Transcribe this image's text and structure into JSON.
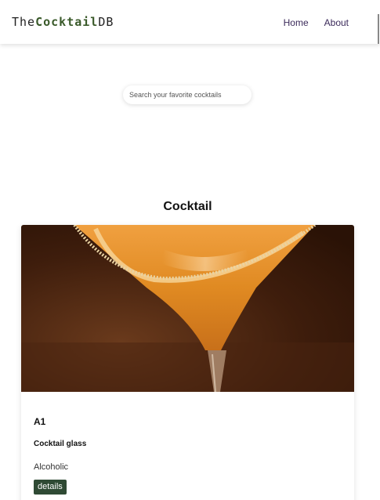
{
  "navbar": {
    "logo_prefix": "The",
    "logo_brand": "Cocktail",
    "logo_suffix": "DB",
    "links": [
      {
        "label": "Home"
      },
      {
        "label": "About"
      }
    ]
  },
  "search": {
    "placeholder": "Search your favorite cocktails",
    "value": ""
  },
  "section": {
    "title": "Cocktail"
  },
  "cocktails": [
    {
      "name": "A1",
      "glass": "Cocktail glass",
      "type": "Alcoholic",
      "details_label": "details",
      "image_icon": "martini-glass-image"
    }
  ],
  "colors": {
    "brand": "#3a5a2a",
    "nav_link": "#3b2a5a",
    "button_bg": "#2f4a34"
  }
}
